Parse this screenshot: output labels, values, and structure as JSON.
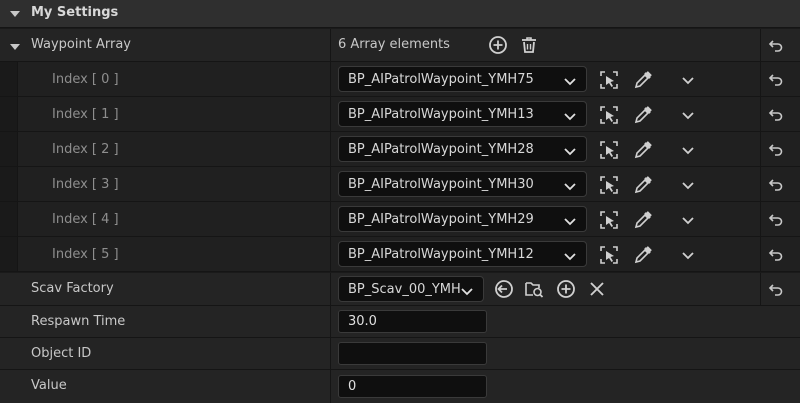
{
  "category": {
    "title": "My Settings"
  },
  "waypoint_array": {
    "label": "Waypoint Array",
    "count_text": "6 Array elements"
  },
  "waypoints": [
    {
      "index_label": "Index [ 0 ]",
      "value": "BP_AIPatrolWaypoint_YMH75"
    },
    {
      "index_label": "Index [ 1 ]",
      "value": "BP_AIPatrolWaypoint_YMH13"
    },
    {
      "index_label": "Index [ 2 ]",
      "value": "BP_AIPatrolWaypoint_YMH28"
    },
    {
      "index_label": "Index [ 3 ]",
      "value": "BP_AIPatrolWaypoint_YMH30"
    },
    {
      "index_label": "Index [ 4 ]",
      "value": "BP_AIPatrolWaypoint_YMH29"
    },
    {
      "index_label": "Index [ 5 ]",
      "value": "BP_AIPatrolWaypoint_YMH12"
    }
  ],
  "scav_factory": {
    "label": "Scav Factory",
    "value": "BP_Scav_00_YMH"
  },
  "respawn_time": {
    "label": "Respawn Time",
    "value": "30.0"
  },
  "object_id": {
    "label": "Object ID",
    "value": ""
  },
  "value_field": {
    "label": "Value",
    "value": "0"
  },
  "icons": {
    "collapse": "triangle-down-icon",
    "add": "plus-circle-icon",
    "delete": "trash-icon",
    "reset": "reset-arrow-icon",
    "pick": "select-actor-icon",
    "eyedropper": "eyedropper-icon",
    "expand": "chevron-down-icon",
    "use_selected": "use-selected-icon",
    "browse": "browse-folder-icon",
    "clear": "close-icon"
  },
  "colors": {
    "background": "#1a1a1a",
    "header": "#2f2f2f",
    "row": "#242424",
    "field": "#0f0f0f"
  }
}
